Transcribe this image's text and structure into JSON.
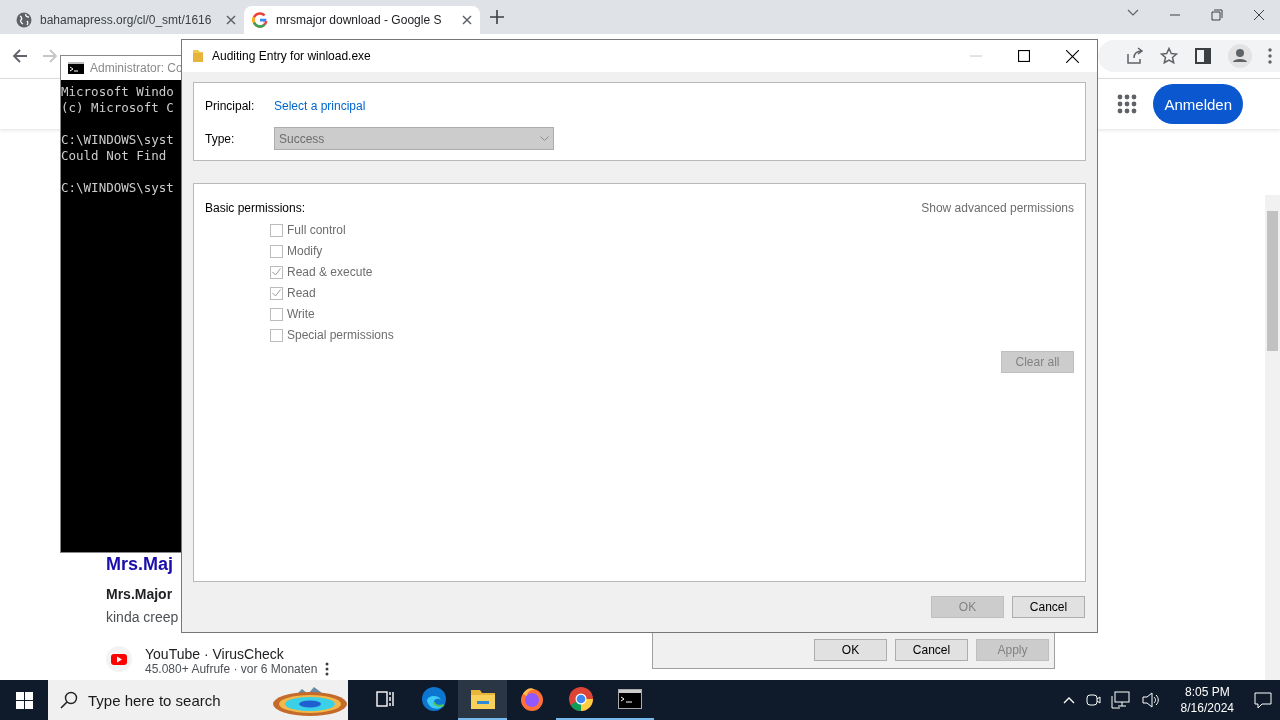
{
  "browser": {
    "tabs": [
      {
        "title": "bahamapress.org/cl/0_smt/1616",
        "kind": "globe",
        "selected": false
      },
      {
        "title": "mrsmajor download - Google S",
        "kind": "g",
        "selected": true
      }
    ],
    "sign_in_button": "Anmelden",
    "results": {
      "title": "Mrs.Maj",
      "source": "Mrs.Major",
      "snippet": "kinda creep",
      "video_source": "YouTube · VirusCheck",
      "video_meta": "45.080+ Aufrufe · vor 6 Monaten"
    }
  },
  "console": {
    "title": "Administrator: Co",
    "blocks": [
      [
        "Microsoft Windo",
        "(c) Microsoft C"
      ],
      [
        "C:\\WINDOWS\\syst",
        "Could Not Find"
      ],
      [
        "C:\\WINDOWS\\syst"
      ]
    ]
  },
  "back_dialog": {
    "buttons": [
      {
        "label": "OK",
        "disabled": false
      },
      {
        "label": "Cancel",
        "disabled": false
      },
      {
        "label": "Apply",
        "disabled": true
      }
    ]
  },
  "dialog": {
    "title": "Auditing Entry for winload.exe",
    "principal_label": "Principal:",
    "principal_link": "Select a principal",
    "type_label": "Type:",
    "type_value": "Success",
    "permissions_label": "Basic permissions:",
    "advanced_link": "Show advanced permissions",
    "permissions": [
      {
        "label": "Full control",
        "checked": false,
        "disabled": true
      },
      {
        "label": "Modify",
        "checked": false,
        "disabled": true
      },
      {
        "label": "Read & execute",
        "checked": true,
        "disabled": true
      },
      {
        "label": "Read",
        "checked": true,
        "disabled": true
      },
      {
        "label": "Write",
        "checked": false,
        "disabled": true
      },
      {
        "label": "Special permissions",
        "checked": false,
        "disabled": true
      }
    ],
    "clear_button": {
      "label": "Clear all",
      "disabled": true
    },
    "buttons": [
      {
        "label": "OK",
        "disabled": true
      },
      {
        "label": "Cancel",
        "disabled": false
      }
    ]
  },
  "taskbar": {
    "search_placeholder": "Type here to search",
    "apps": [
      {
        "kind": "taskview",
        "selected": false,
        "running": false
      },
      {
        "kind": "edge",
        "selected": false,
        "running": false
      },
      {
        "kind": "explorer",
        "selected": true,
        "running": true
      },
      {
        "kind": "firefox",
        "selected": false,
        "running": false
      },
      {
        "kind": "chrome",
        "selected": false,
        "running": true
      },
      {
        "kind": "terminal",
        "selected": false,
        "running": true
      }
    ],
    "time": "8:05 PM",
    "date": "8/16/2024"
  }
}
